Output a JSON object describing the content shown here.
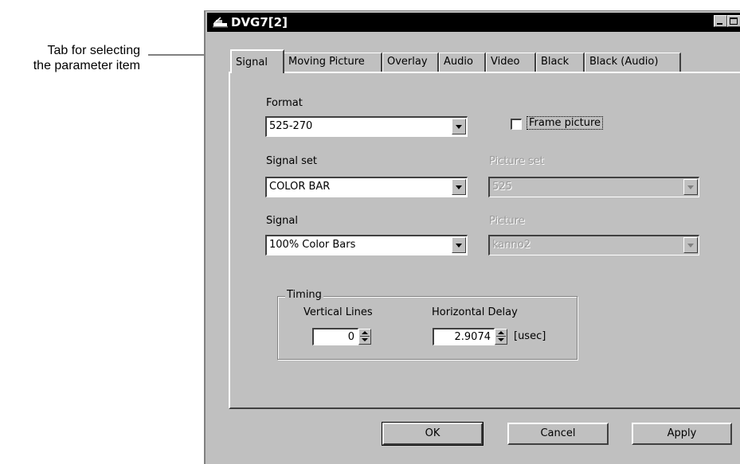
{
  "callout": {
    "line1": "Tab for selecting",
    "line2": "the parameter item"
  },
  "window": {
    "title": "DVG7[2]",
    "icon": "app-icon",
    "controls": [
      "minimize-icon",
      "maximize-icon",
      "close-icon"
    ]
  },
  "tabs": [
    {
      "label": "Signal",
      "active": true
    },
    {
      "label": "Moving Picture",
      "active": false
    },
    {
      "label": "Overlay",
      "active": false
    },
    {
      "label": "Audio",
      "active": false
    },
    {
      "label": "Video",
      "active": false
    },
    {
      "label": "Black",
      "active": false
    },
    {
      "label": "Black (Audio)",
      "active": false
    }
  ],
  "form": {
    "format_label": "Format",
    "format_value": "525-270",
    "frame_picture_label": "Frame picture",
    "frame_picture_checked": false,
    "signal_set_label": "Signal set",
    "signal_set_value": "COLOR BAR",
    "picture_set_label": "Picture set",
    "picture_set_value": "525",
    "signal_label": "Signal",
    "signal_value": "100% Color Bars",
    "picture_label": "Picture",
    "picture_value": "kanno2"
  },
  "timing": {
    "group_label": "Timing",
    "vertical_lines_label": "Vertical Lines",
    "vertical_lines_value": "0",
    "horizontal_delay_label": "Horizontal Delay",
    "horizontal_delay_value": "2.9074",
    "unit": "[usec]"
  },
  "buttons": {
    "ok": "OK",
    "cancel": "Cancel",
    "apply": "Apply"
  },
  "colors": {
    "face": "#c0c0c0",
    "titlebar": "#000000",
    "disabled_text": "#9a9a9a"
  }
}
